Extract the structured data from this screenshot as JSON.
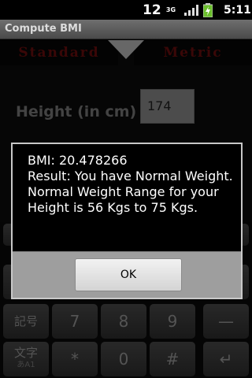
{
  "status_bar": {
    "notification_count": "12",
    "network_type_top": "3G",
    "network_type_bottom": "",
    "time": "5:11",
    "signal_icon": "signal-bars-icon",
    "battery_icon": "battery-charging-icon",
    "battery_color": "#6abf2b"
  },
  "app": {
    "title": "Compute BMI",
    "tabs": [
      {
        "label": "Standard"
      },
      {
        "label": "Metric"
      }
    ],
    "tab_color": "#6b0e0e",
    "height_label": "Height (in cm)",
    "height_value": "174"
  },
  "keyboard": {
    "rows": [
      [
        "記号",
        "7",
        "8",
        "9",
        "—"
      ],
      [
        "文字",
        "*",
        "0",
        "#",
        "↵"
      ]
    ],
    "sub_label": "あA1"
  },
  "dialog": {
    "lines": [
      "BMI: 20.478266",
      "Result: You have Normal Weight.",
      "Normal Weight Range for your Height is 56 Kgs to 75 Kgs."
    ],
    "ok_label": "OK"
  }
}
